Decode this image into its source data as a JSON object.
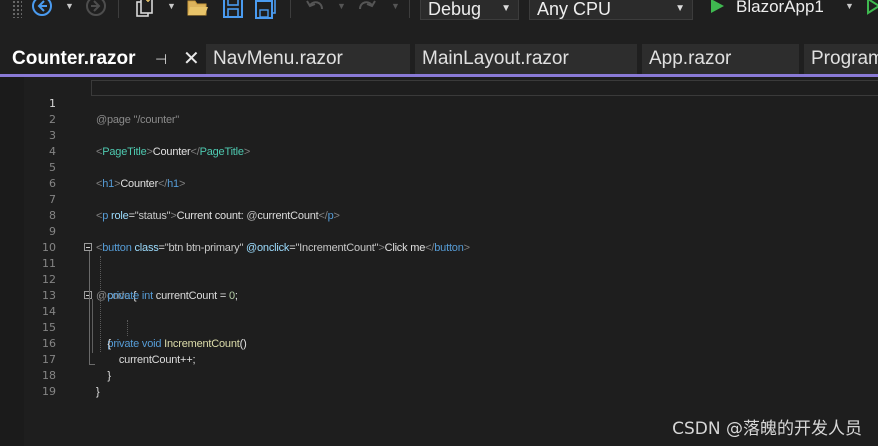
{
  "toolbar": {
    "config_value": "Debug",
    "platform_value": "Any CPU",
    "startup_project": "BlazorApp1",
    "icons": [
      "grip-icon",
      "navigate-back-icon",
      "navigate-forward-icon",
      "new-project-icon",
      "open-folder-icon",
      "save-icon",
      "save-all-icon",
      "undo-icon",
      "redo-icon",
      "start-debug-icon"
    ]
  },
  "tabs": [
    {
      "label": "Counter.razor",
      "active": true
    },
    {
      "label": "NavMenu.razor",
      "active": false
    },
    {
      "label": "MainLayout.razor",
      "active": false
    },
    {
      "label": "App.razor",
      "active": false
    },
    {
      "label": "Program",
      "active": false
    }
  ],
  "editor": {
    "current_line": 1,
    "line_numbers": [
      "1",
      "2",
      "3",
      "4",
      "5",
      "6",
      "7",
      "8",
      "9",
      "10",
      "11",
      "12",
      "13",
      "14",
      "15",
      "16",
      "17",
      "18",
      "19"
    ],
    "lines": [
      {
        "text": "@page \"/counter\""
      },
      {
        "text": ""
      },
      {
        "text": "<PageTitle>Counter</PageTitle>"
      },
      {
        "text": ""
      },
      {
        "text": "<h1>Counter</h1>"
      },
      {
        "text": ""
      },
      {
        "text": "<p role=\"status\">Current count: @currentCount</p>"
      },
      {
        "text": ""
      },
      {
        "text": "<button class=\"btn btn-primary\" @onclick=\"IncrementCount\">Click me</button>"
      },
      {
        "text": ""
      },
      {
        "text": "@code {"
      },
      {
        "text": "    private int currentCount = 0;"
      },
      {
        "text": ""
      },
      {
        "text": "    private void IncrementCount()"
      },
      {
        "text": "    {"
      },
      {
        "text": "        currentCount++;"
      },
      {
        "text": "    }"
      },
      {
        "text": "}"
      },
      {
        "text": ""
      }
    ]
  },
  "watermark": "CSDN @落魄的开发人员",
  "colors": {
    "accent_tab_underline": "#8a7ad6",
    "razor_directive": "#8a8a8a",
    "html_tag": "#569cd6",
    "component_tag": "#4ec9b0",
    "attribute": "#9cdcfe",
    "keyword": "#569cd6",
    "method": "#dcdcaa",
    "number": "#b5cea8"
  }
}
